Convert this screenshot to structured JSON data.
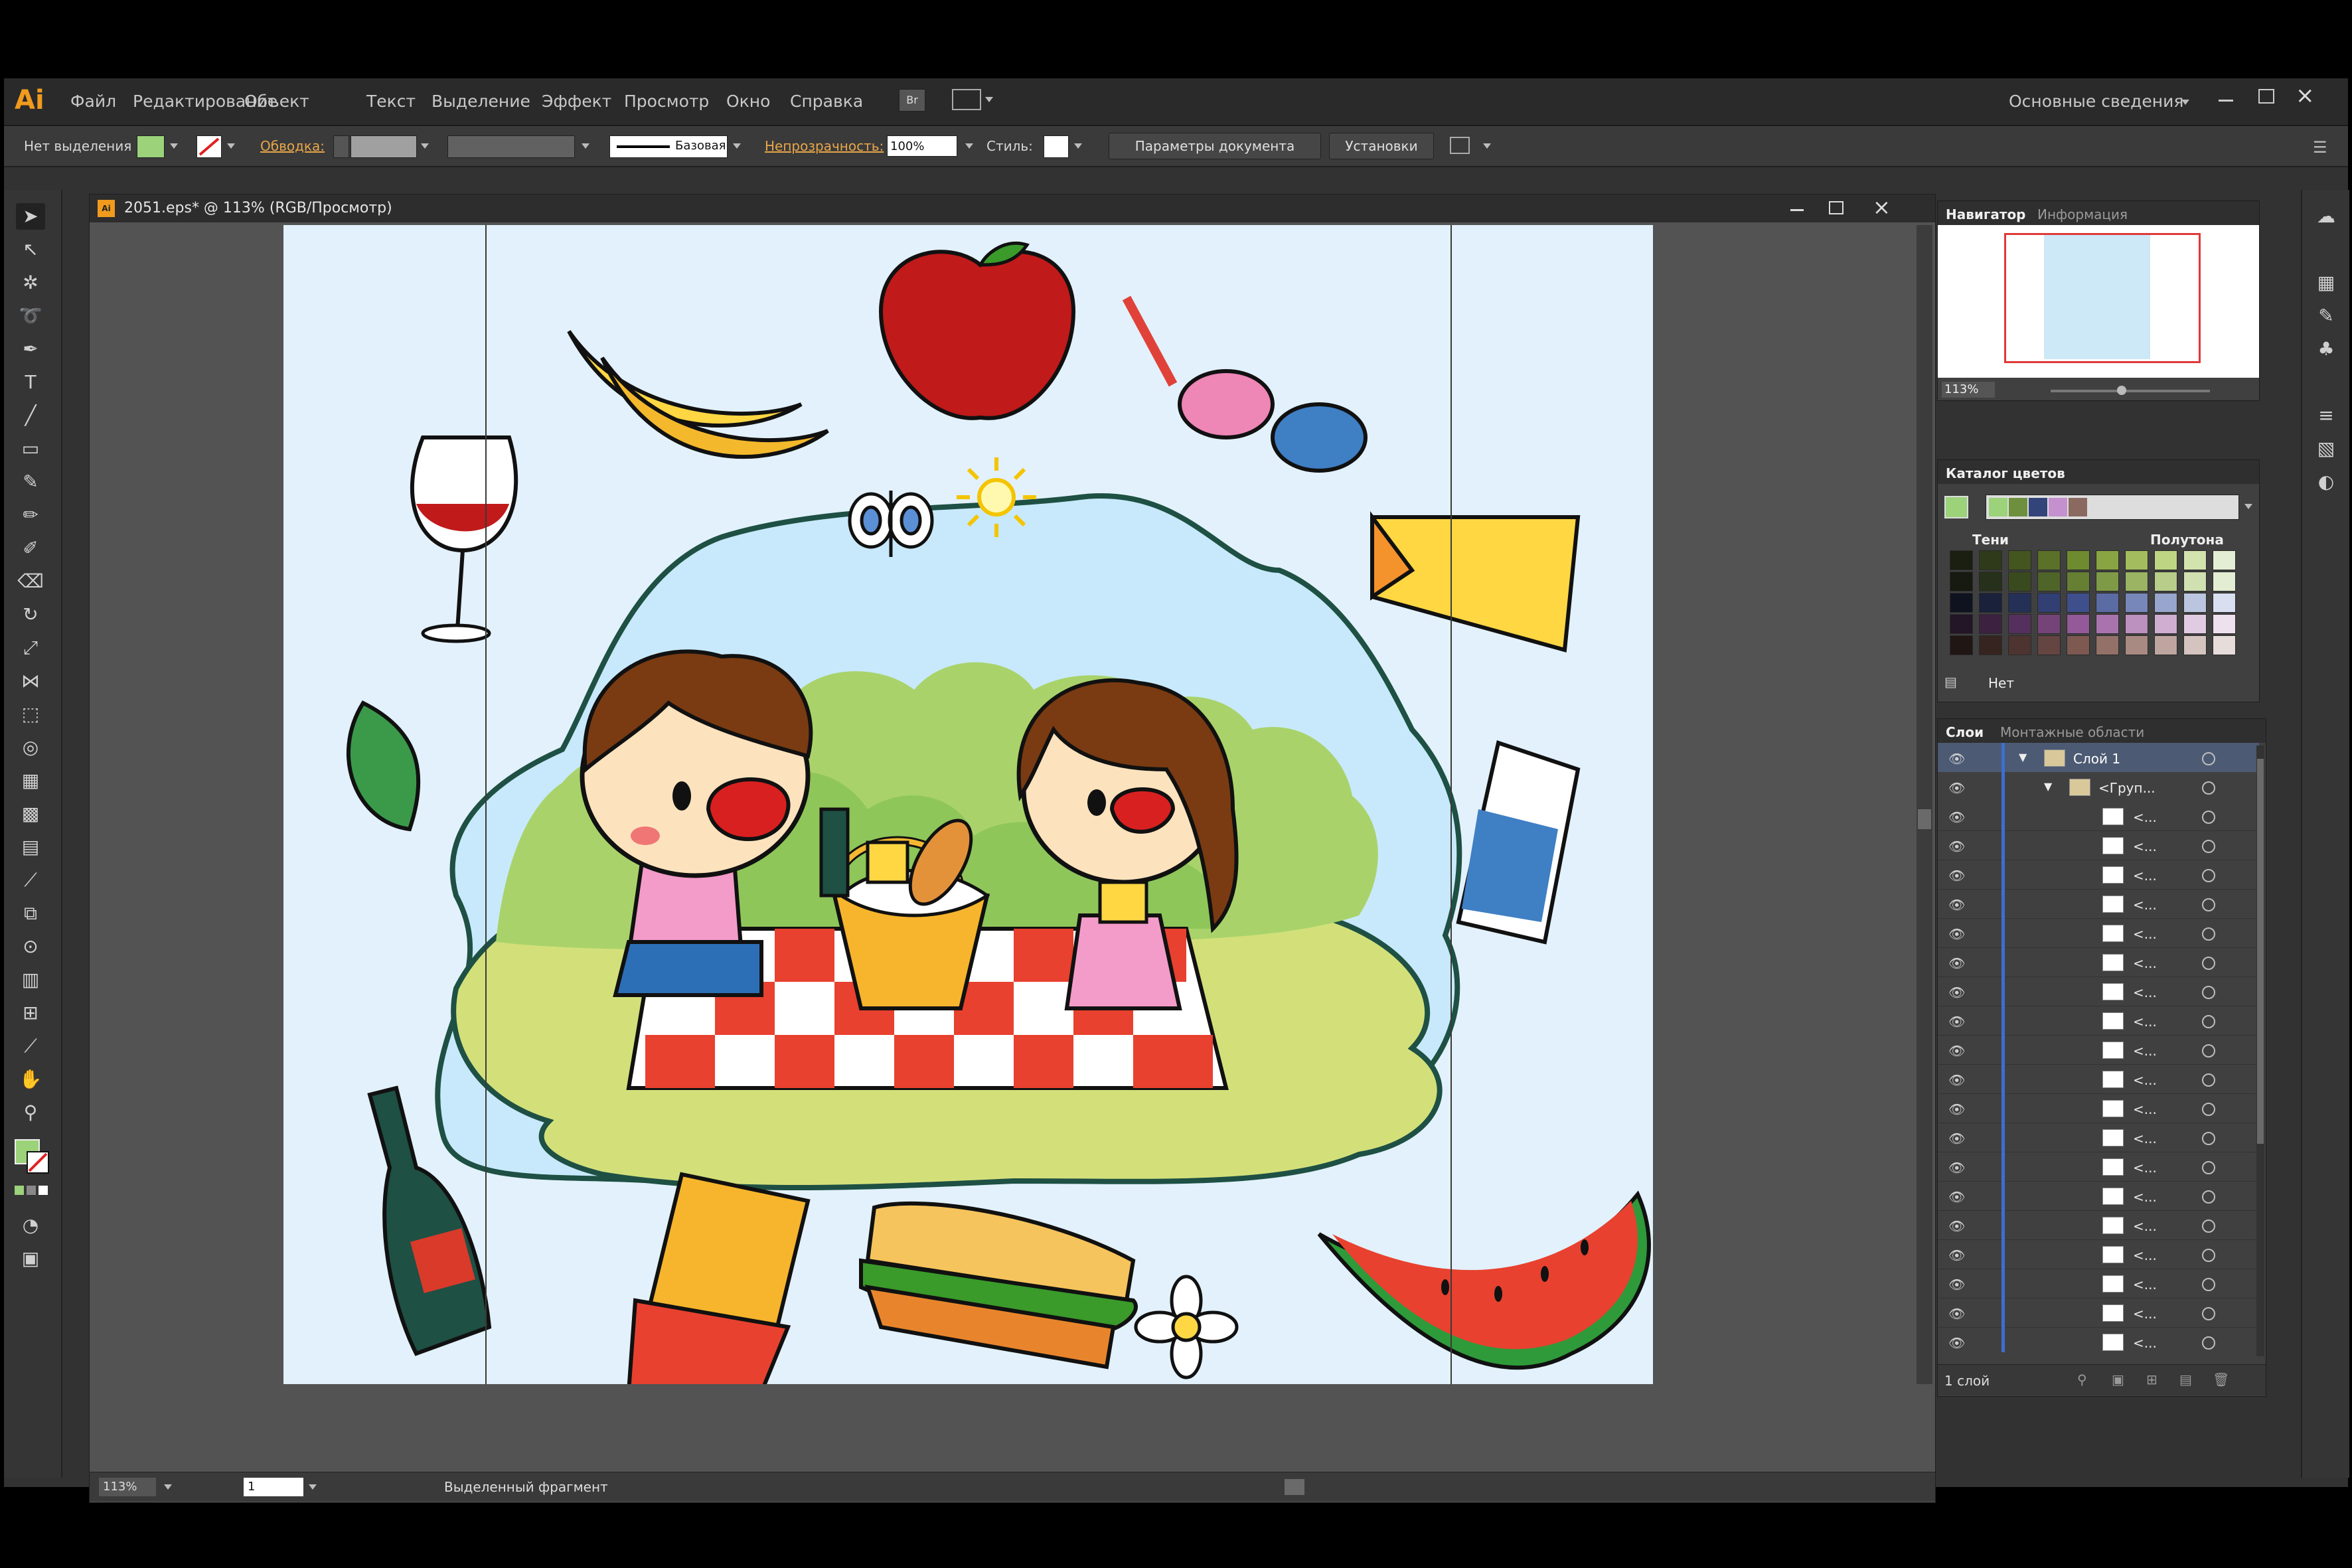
{
  "app": {
    "logo": "Ai",
    "workspace": "Основные сведения"
  },
  "menu": [
    "Файл",
    "Редактирование",
    "Объект",
    "Текст",
    "Выделение",
    "Эффект",
    "Просмотр",
    "Окно",
    "Справка"
  ],
  "menu_icons": {
    "bridge": "Br"
  },
  "control": {
    "selection": "Нет выделения",
    "stroke_label": "Обводка:",
    "stroke_profile": "Базовая",
    "opacity_label": "Непрозрачность:",
    "opacity_value": "100%",
    "style_label": "Стиль:",
    "doc_settings": "Параметры документа",
    "preferences": "Установки",
    "fill_color": "#9bd27a"
  },
  "document": {
    "title": "2051.eps* @ 113% (RGB/Просмотр)",
    "zoom": "113%",
    "artboard_number": "1",
    "status_text": "Выделенный фрагмент"
  },
  "navigator": {
    "tab_active": "Навигатор",
    "tab_other": "Информация",
    "zoom": "113%"
  },
  "color_guide": {
    "title": "Каталог цветов",
    "shades_label": "Тени",
    "tints_label": "Полутона",
    "none_label": "Нет",
    "harmony": [
      "#9bd27a",
      "#6e8f3e",
      "#33447a",
      "#c490cd",
      "#8a6a60"
    ],
    "grid": [
      [
        "#1b1f12",
        "#2e3a1a",
        "#44551f",
        "#5b7029",
        "#6f8b30",
        "#89a442",
        "#a3bd5e",
        "#bed684",
        "#d3e3ae",
        "#e4eed4"
      ],
      [
        "#161a10",
        "#26301a",
        "#3a4a1f",
        "#4f6428",
        "#667f33",
        "#7f9a47",
        "#9ab463",
        "#b7cd89",
        "#d0e0b0",
        "#e3edd3"
      ],
      [
        "#0f1320",
        "#1a213b",
        "#253057",
        "#313f72",
        "#3f4f8c",
        "#5b6ba4",
        "#7887b9",
        "#98a5cc",
        "#bcc5df",
        "#d9def0"
      ],
      [
        "#231626",
        "#3c2240",
        "#55305c",
        "#744479",
        "#935998",
        "#a974ad",
        "#bc90bf",
        "#cfaed1",
        "#e0cbe2",
        "#ede1ee"
      ],
      [
        "#201614",
        "#362421",
        "#4d3430",
        "#654541",
        "#7d5952",
        "#937169",
        "#a98a83",
        "#bfa5a0",
        "#d4c3bf",
        "#e6dcda"
      ]
    ]
  },
  "layers": {
    "tab_active": "Слои",
    "tab_other": "Монтажные области",
    "layer_name": "Слой 1",
    "group_name": "<Груп...",
    "item_name": "<...",
    "item_count": 19,
    "footer": "1 слой"
  },
  "artwork_colors": {
    "sky": "#c8e9fb",
    "grass": "#a9d36a",
    "bush": "#7dbf4e",
    "blanket": "#e8412f"
  }
}
